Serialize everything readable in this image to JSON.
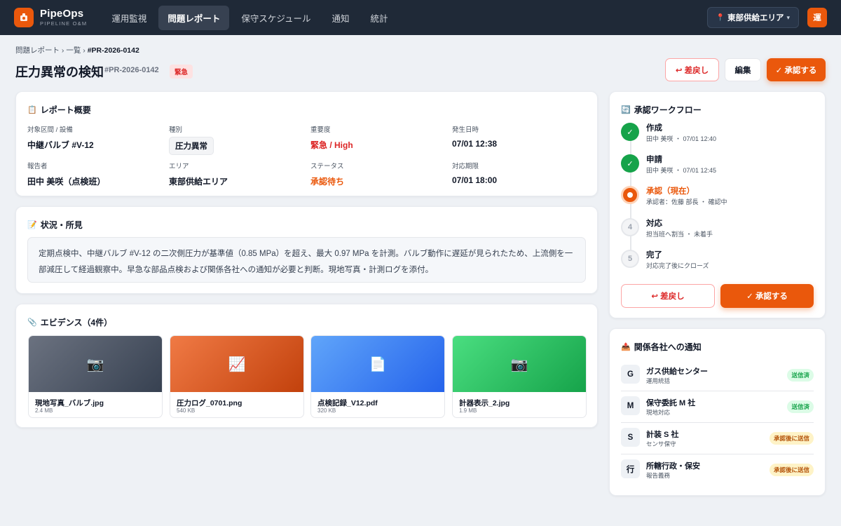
{
  "app": {
    "name": "PipeOps",
    "subtitle": "PIPELINE O&M",
    "nav": [
      {
        "label": "運用監視"
      },
      {
        "label": "問題レポート"
      },
      {
        "label": "保守スケジュール"
      },
      {
        "label": "通知"
      },
      {
        "label": "統計"
      }
    ],
    "region": "東部供給エリア",
    "avatar": "運"
  },
  "breadcrumb": {
    "root": "問題レポート",
    "sep1": "›",
    "list": "一覧",
    "sep2": "›",
    "current": "#PR-2026-0142"
  },
  "header": {
    "title": "圧力異常の検知",
    "report_id": "#PR-2026-0142",
    "urgent_tag": "緊急",
    "return_label": "↩ 差戻し",
    "edit_label": "編集",
    "approve_label": "✓ 承認する"
  },
  "overview": {
    "title": "レポート概要",
    "fields": [
      {
        "label": "対象区間 / 設備",
        "value": "中継バルブ #V-12"
      },
      {
        "label": "種別",
        "value": "圧力異常"
      },
      {
        "label": "重要度",
        "value": "緊急 / High"
      },
      {
        "label": "発生日時",
        "value": "07/01 12:38"
      },
      {
        "label": "報告者",
        "value": "田中 美咲（点検班）"
      },
      {
        "label": "エリア",
        "value": "東部供給エリア"
      },
      {
        "label": "ステータス",
        "value": "承認待ち"
      },
      {
        "label": "対応期限",
        "value": "07/01 18:00"
      }
    ]
  },
  "situation": {
    "title": "状況・所見",
    "text": "定期点検中、中継バルブ #V-12 の二次側圧力が基準値（0.85 MPa）を超え、最大 0.97 MPa を計測。バルブ動作に遅延が見られたため、上流側を一部減圧して経過観察中。早急な部品点検および関係各社への通知が必要と判断。現地写真・計測ログを添付。"
  },
  "evidence": {
    "title": "エビデンス（4件）",
    "items": [
      {
        "name": "現地写真_バルブ.jpg",
        "size": "2.4 MB",
        "icon": "camera-icon",
        "color": "#4b5563"
      },
      {
        "name": "圧力ログ_0701.png",
        "size": "540 KB",
        "icon": "chart-icon",
        "color": "#d9531e"
      },
      {
        "name": "点検記録_V12.pdf",
        "size": "320 KB",
        "icon": "document-icon",
        "color": "#3b82f6"
      },
      {
        "name": "計器表示_2.jpg",
        "size": "1.9 MB",
        "icon": "camera-icon",
        "color": "#22a34d"
      }
    ]
  },
  "workflow": {
    "title": "承認ワークフロー",
    "steps": [
      {
        "name": "作成",
        "meta": "田中 美咲 ・ 07/01 12:40",
        "state": "done",
        "mark": "✓"
      },
      {
        "name": "申請",
        "meta": "田中 美咲 ・ 07/01 12:45",
        "state": "done",
        "mark": "✓"
      },
      {
        "name": "承認（現在）",
        "meta": "承認者：佐藤 部長 ・ 確認中",
        "state": "current",
        "mark": ""
      },
      {
        "name": "対応",
        "meta": "担当班へ割当 ・ 未着手",
        "state": "pending",
        "mark": "4"
      },
      {
        "name": "完了",
        "meta": "対応完了後にクローズ",
        "state": "pending",
        "mark": "5"
      }
    ],
    "return_label": "↩ 差戻し",
    "approve_label": "✓ 承認する"
  },
  "notify": {
    "title": "関係各社への通知",
    "items": [
      {
        "initial": "G",
        "name": "ガス供給センター",
        "sub": "運用統括",
        "status": "送信済",
        "state": "sent"
      },
      {
        "initial": "M",
        "name": "保守委託 M 社",
        "sub": "現地対応",
        "status": "送信済",
        "state": "sent"
      },
      {
        "initial": "S",
        "name": "計装 S 社",
        "sub": "センサ保守",
        "status": "承認後に送信",
        "state": "pending"
      },
      {
        "initial": "行",
        "name": "所轄行政・保安",
        "sub": "報告義務",
        "status": "承認後に送信",
        "state": "pending"
      }
    ]
  },
  "colors": {
    "accent": "#ea580c",
    "danger": "#dc2626",
    "success": "#16a34a",
    "nav_bg": "#1f2937"
  }
}
